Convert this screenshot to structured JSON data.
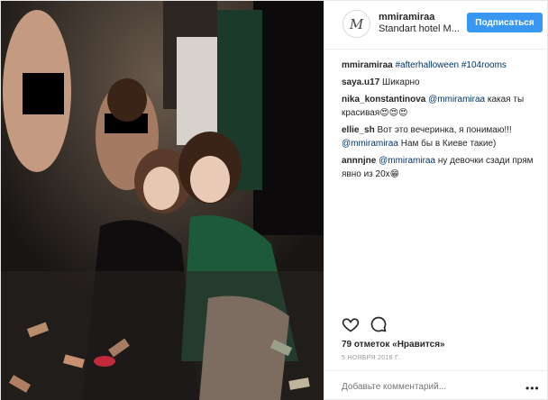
{
  "post": {
    "user": {
      "avatar_glyph": "M",
      "username": "mmiramiraa",
      "location": "Standart hotel M...",
      "follow_label": "Подписаться"
    },
    "caption": {
      "user": "mmiramiraa",
      "text": "#afterhalloween #104rooms"
    },
    "comments": [
      {
        "user": "saya.u17",
        "text": "Шикарно"
      },
      {
        "user": "nika_konstantinova",
        "text": "@mmiramiraa какая ты красивая😍😍😍"
      },
      {
        "user": "ellie_sh",
        "text": "Вот это вечеринка, я понимаю!!! @mmiramiraa Нам бы в Киеве такие)"
      },
      {
        "user": "annnjne",
        "text": "@mmiramiraa ну девочки сзади прям явно из 20х😁"
      }
    ],
    "actions": {
      "like_icon": "heart-icon",
      "comment_icon": "comment-bubble-icon"
    },
    "likes": "79 отметок «Нравится»",
    "date": "5 НОЯБРЯ 2016 Г.",
    "add_comment_placeholder": "Добавьте комментарий...",
    "more_label": "•••"
  },
  "colors": {
    "accent": "#3897f0",
    "link": "#003569",
    "text": "#262626",
    "muted": "#999999"
  }
}
